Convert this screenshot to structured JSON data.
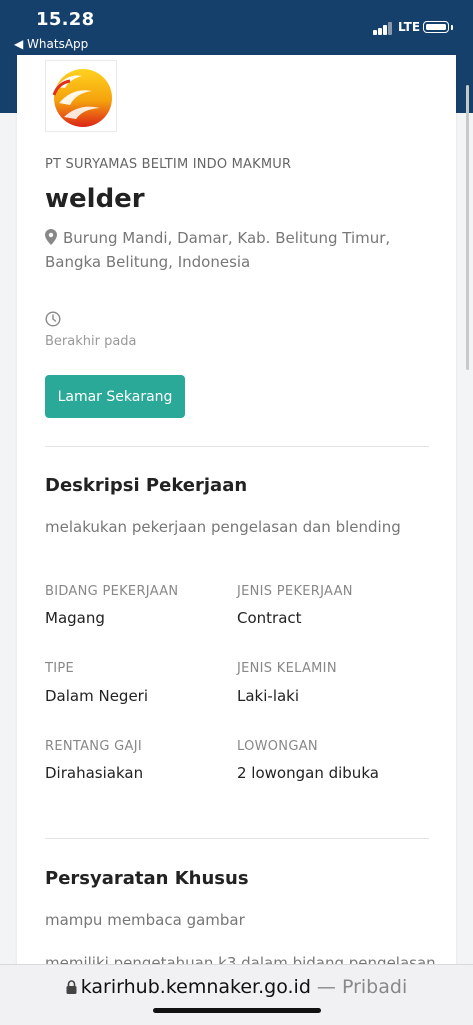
{
  "status_bar": {
    "time": "15.28",
    "back_app": "◀ WhatsApp",
    "network": "LTE"
  },
  "job": {
    "company": "PT SURYAMAS BELTIM INDO MAKMUR",
    "title": "welder",
    "location": "Burung Mandi, Damar, Kab. Belitung Timur, Bangka Belitung, Indonesia",
    "deadline_label": "Berakhir pada",
    "apply_label": "Lamar Sekarang"
  },
  "description": {
    "heading": "Deskripsi Pekerjaan",
    "text": "melakukan pekerjaan pengelasan dan blending"
  },
  "details": {
    "bidang_label": "BIDANG PEKERJAAN",
    "bidang_value": "Magang",
    "jenis_label": "JENIS PEKERJAAN",
    "jenis_value": "Contract",
    "tipe_label": "TIPE",
    "tipe_value": "Dalam Negeri",
    "kelamin_label": "JENIS KELAMIN",
    "kelamin_value": "Laki-laki",
    "gaji_label": "RENTANG GAJI",
    "gaji_value": "Dirahasiakan",
    "lowongan_label": "LOWONGAN",
    "lowongan_value": "2 lowongan dibuka"
  },
  "requirements": {
    "heading": "Persyaratan Khusus",
    "items": [
      "mampu membaca gambar",
      "memiliki pengetahuan k3 dalam bidang pengelasan"
    ]
  },
  "browser": {
    "url": "karirhub.kemnaker.go.id",
    "separator": " — ",
    "mode": "Pribadi"
  },
  "colors": {
    "header": "#15406b",
    "accent": "#2aa898"
  }
}
